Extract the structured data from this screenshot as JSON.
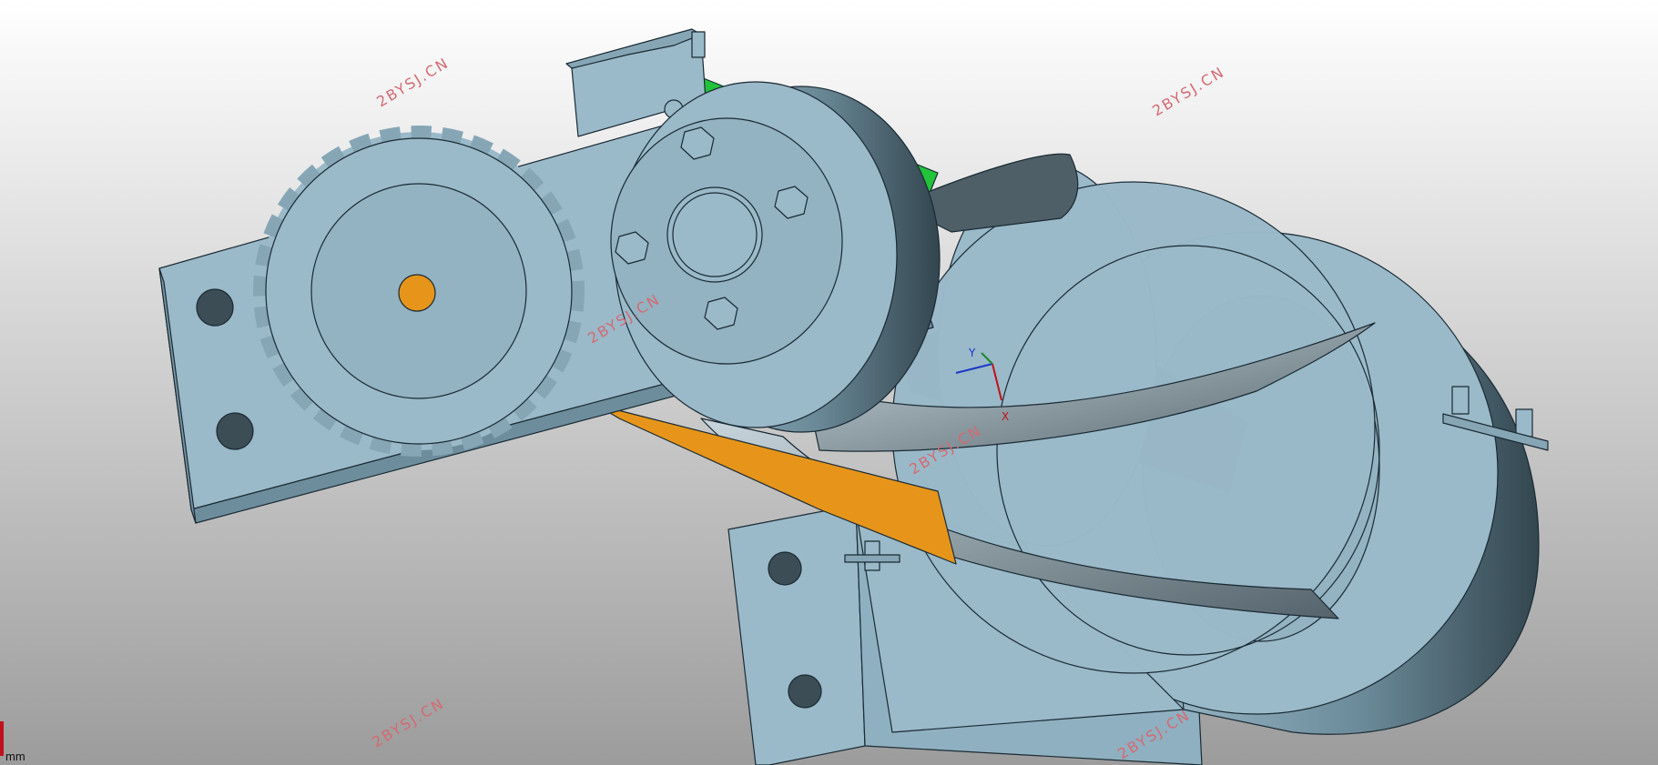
{
  "viewport": {
    "background_top": "#ffffff",
    "background_bottom": "#9c9c9c",
    "units_label": "mm"
  },
  "colors": {
    "part_light": "#9ab9c9",
    "part_mid": "#86a6b6",
    "part_dark": "#4e6a78",
    "edge": "#1a2a33",
    "accent_orange": "#e6951a",
    "accent_green": "#22c33a",
    "shaft_dark": "#3c3f42",
    "watermark": "#d46a72",
    "axis_x": "#c0111a",
    "axis_y": "#1c38c8"
  },
  "watermarks": [
    "2BYSJ.CN",
    "2BYSJ.CN",
    "2BYSJ.CN",
    "2BYSJ.CN",
    "2BYSJ.CN",
    "2BYSJ.CN",
    "2BYSJ.CN"
  ],
  "triad": {
    "x_label": "X",
    "y_label": "Y"
  }
}
